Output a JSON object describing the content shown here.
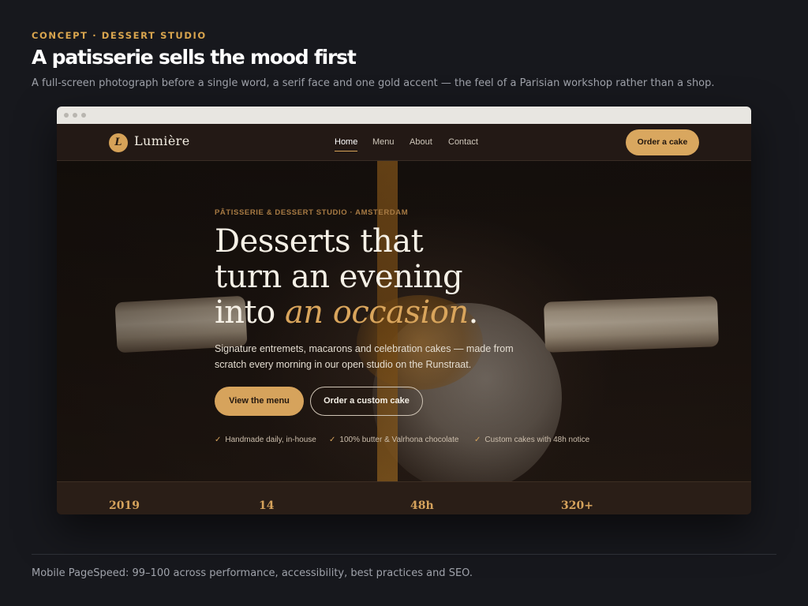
{
  "intro": {
    "concept": "CONCEPT · DESSERT STUDIO",
    "headline": "A patisserie sells the mood first",
    "subline": "A full-screen photograph before a single word, a serif face and one gold accent — the feel of a Parisian workshop rather than a shop."
  },
  "site": {
    "logo_letter": "L",
    "brand": "Lumière",
    "nav": [
      "Home",
      "Menu",
      "About",
      "Contact"
    ],
    "active_nav": "Home",
    "order_button": "Order a cake",
    "hero": {
      "eyebrow": "PÂTISSERIE & DESSERT STUDIO · AMSTERDAM",
      "title_line1": "Desserts that",
      "title_line2": "turn an evening",
      "title_line3_start": "into ",
      "title_accent": "an occasion",
      "title_end": ".",
      "lede": "Signature entremets, macarons and celebration cakes — made from scratch every morning in our open studio on the Runstraat.",
      "primary_button": "View the menu",
      "secondary_button": "Order a custom cake",
      "features": [
        "Handmade daily, in-house",
        "100% butter & Valrhona chocolate",
        "Custom cakes with 48h notice"
      ],
      "check_glyph": "✓"
    },
    "stats": [
      "2019",
      "14",
      "48h",
      "320+"
    ]
  },
  "footer": "Mobile PageSpeed: 99–100 across performance, accessibility, best practices and SEO.",
  "colors": {
    "accent": "#d6a35c",
    "background": "#17181d",
    "nav": "#231915"
  }
}
